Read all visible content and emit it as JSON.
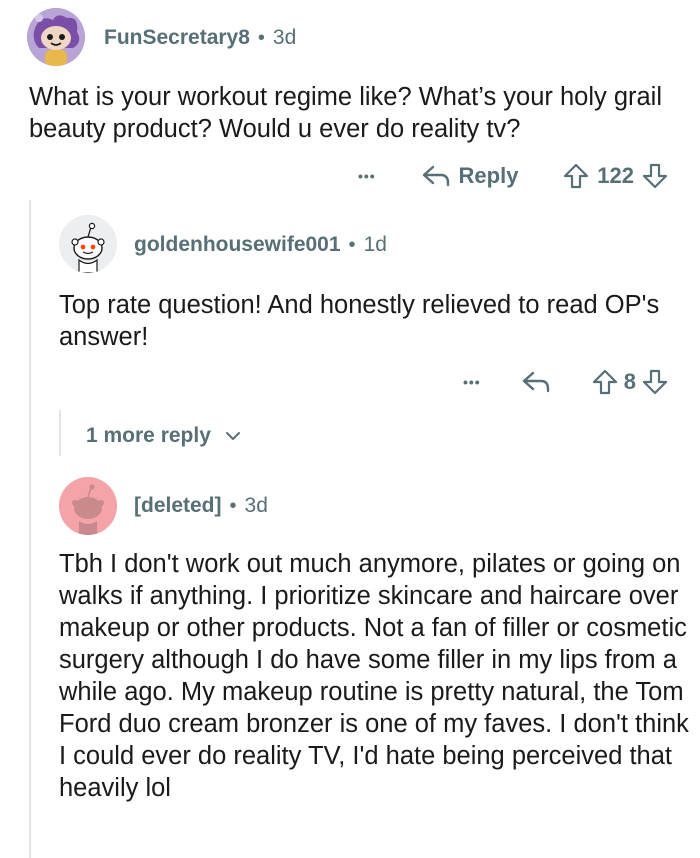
{
  "comment1": {
    "username": "FunSecretary8",
    "age": "3d",
    "body": "What is your workout regime like? What’s your holy grail beauty product? Would u ever do reality tv?",
    "reply_label": "Reply",
    "score": "122",
    "colors": {
      "avatar_bg": "#b8a4d6"
    }
  },
  "comment2": {
    "username": "goldenhousewife001",
    "age": "1d",
    "body": "Top rate question! And honestly relieved to read OP's answer!",
    "score": "8",
    "colors": {
      "avatar_bg": "#eceef0"
    }
  },
  "more_replies": {
    "label": "1 more reply"
  },
  "comment3": {
    "username": "[deleted]",
    "age": "3d",
    "body": "Tbh I don't work out much anymore, pilates or going on walks if anything. I prioritize skincare and haircare over makeup or other products. Not a fan of filler or cosmetic surgery although I do have some filler in my lips from a while ago. My makeup routine is pretty natural, the Tom Ford duo cream bronzer is one of my faves. I don't think I could ever do reality TV, I'd hate being perceived that heavily lol",
    "colors": {
      "avatar_bg": "#f4a3a8"
    }
  },
  "separator": "•",
  "overflow_glyph": "•••"
}
